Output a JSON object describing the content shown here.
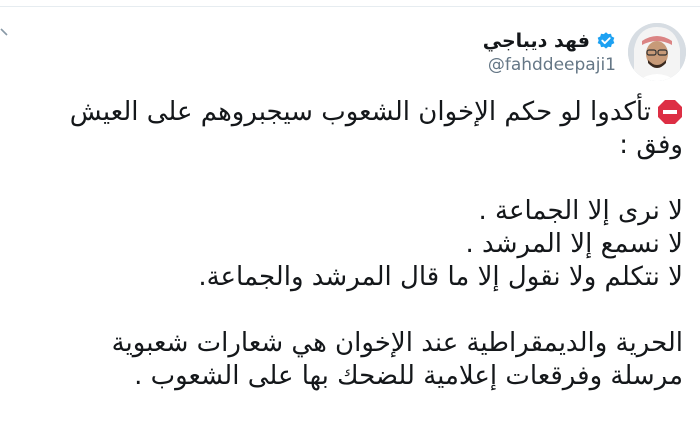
{
  "user": {
    "display_name": "فهد ديباجي",
    "handle": "@fahddeepaji1"
  },
  "tweet": {
    "line1": "تأكدوا لو حكم الإخوان الشعوب سيجبروهم على العيش",
    "line2": "وفق :",
    "line3": "لا نرى إلا الجماعة .",
    "line4": "لا نسمع إلا المرشد .",
    "line5": "لا نتكلم ولا نقول إلا ما قال المرشد والجماعة.",
    "line6": "الحرية والديمقراطية عند الإخوان هي شعارات شعبوية",
    "line7": "مرسلة وفرقعات إعلامية للضحك بها على الشعوب ."
  },
  "colors": {
    "verified": "#1da1f2",
    "stop_sign": "#dd2e44",
    "text": "#14171a",
    "handle": "#657786"
  },
  "icons": [
    "verified-badge-icon",
    "stop-sign-icon",
    "chevron-down-icon"
  ]
}
